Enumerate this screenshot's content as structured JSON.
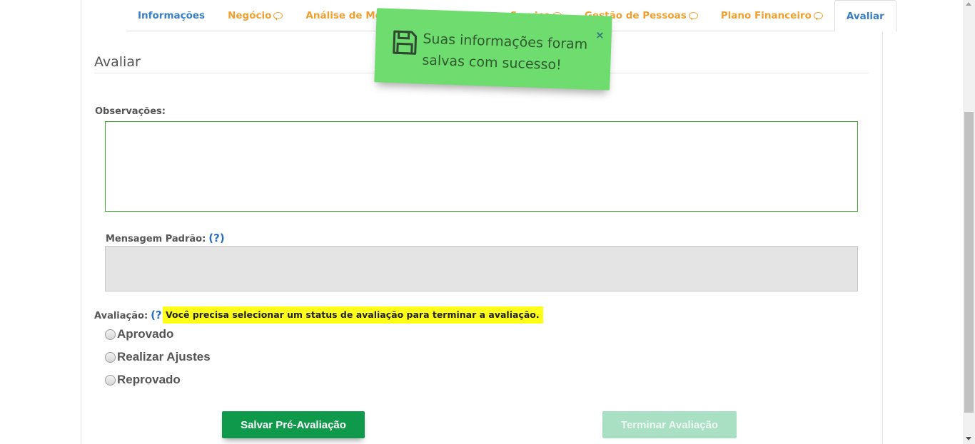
{
  "tabs": [
    {
      "label": "Informações",
      "has_comment": false
    },
    {
      "label": "Negócio",
      "has_comment": true
    },
    {
      "label": "Análise de Mercado",
      "has_comment": true
    },
    {
      "label": "Produto ou Serviço",
      "has_comment": true
    },
    {
      "label": "Gestão de Pessoas",
      "has_comment": true
    },
    {
      "label": "Plano Financeiro",
      "has_comment": true
    },
    {
      "label": "Avaliar",
      "has_comment": false,
      "active": true
    }
  ],
  "section": {
    "title": "Avaliar"
  },
  "observacoes": {
    "label": "Observações:",
    "value": ""
  },
  "mensagem_padrao": {
    "label": "Mensagem Padrão:",
    "help": "(?)",
    "value": ""
  },
  "avaliacao": {
    "label": "Avaliação:",
    "help": "(?)",
    "warning": "Você precisa selecionar um status de avaliação para terminar a avaliação.",
    "options": [
      "Aprovado",
      "Realizar Ajustes",
      "Reprovado"
    ],
    "selected": null
  },
  "buttons": {
    "save": "Salvar Pré-Avaliação",
    "finish": "Terminar Avaliação"
  },
  "toast": {
    "message": "Suas informações foram salvas com sucesso!",
    "close": "×",
    "icon": "floppy-disk-icon",
    "color": "#6fdc6f"
  },
  "colors": {
    "tab_orange": "#f0a030",
    "tab_blue": "#3a7fc4",
    "save_green": "#0e9a4a",
    "finish_disabled": "#a9dfc2",
    "warning_yellow": "#ffff1a"
  }
}
